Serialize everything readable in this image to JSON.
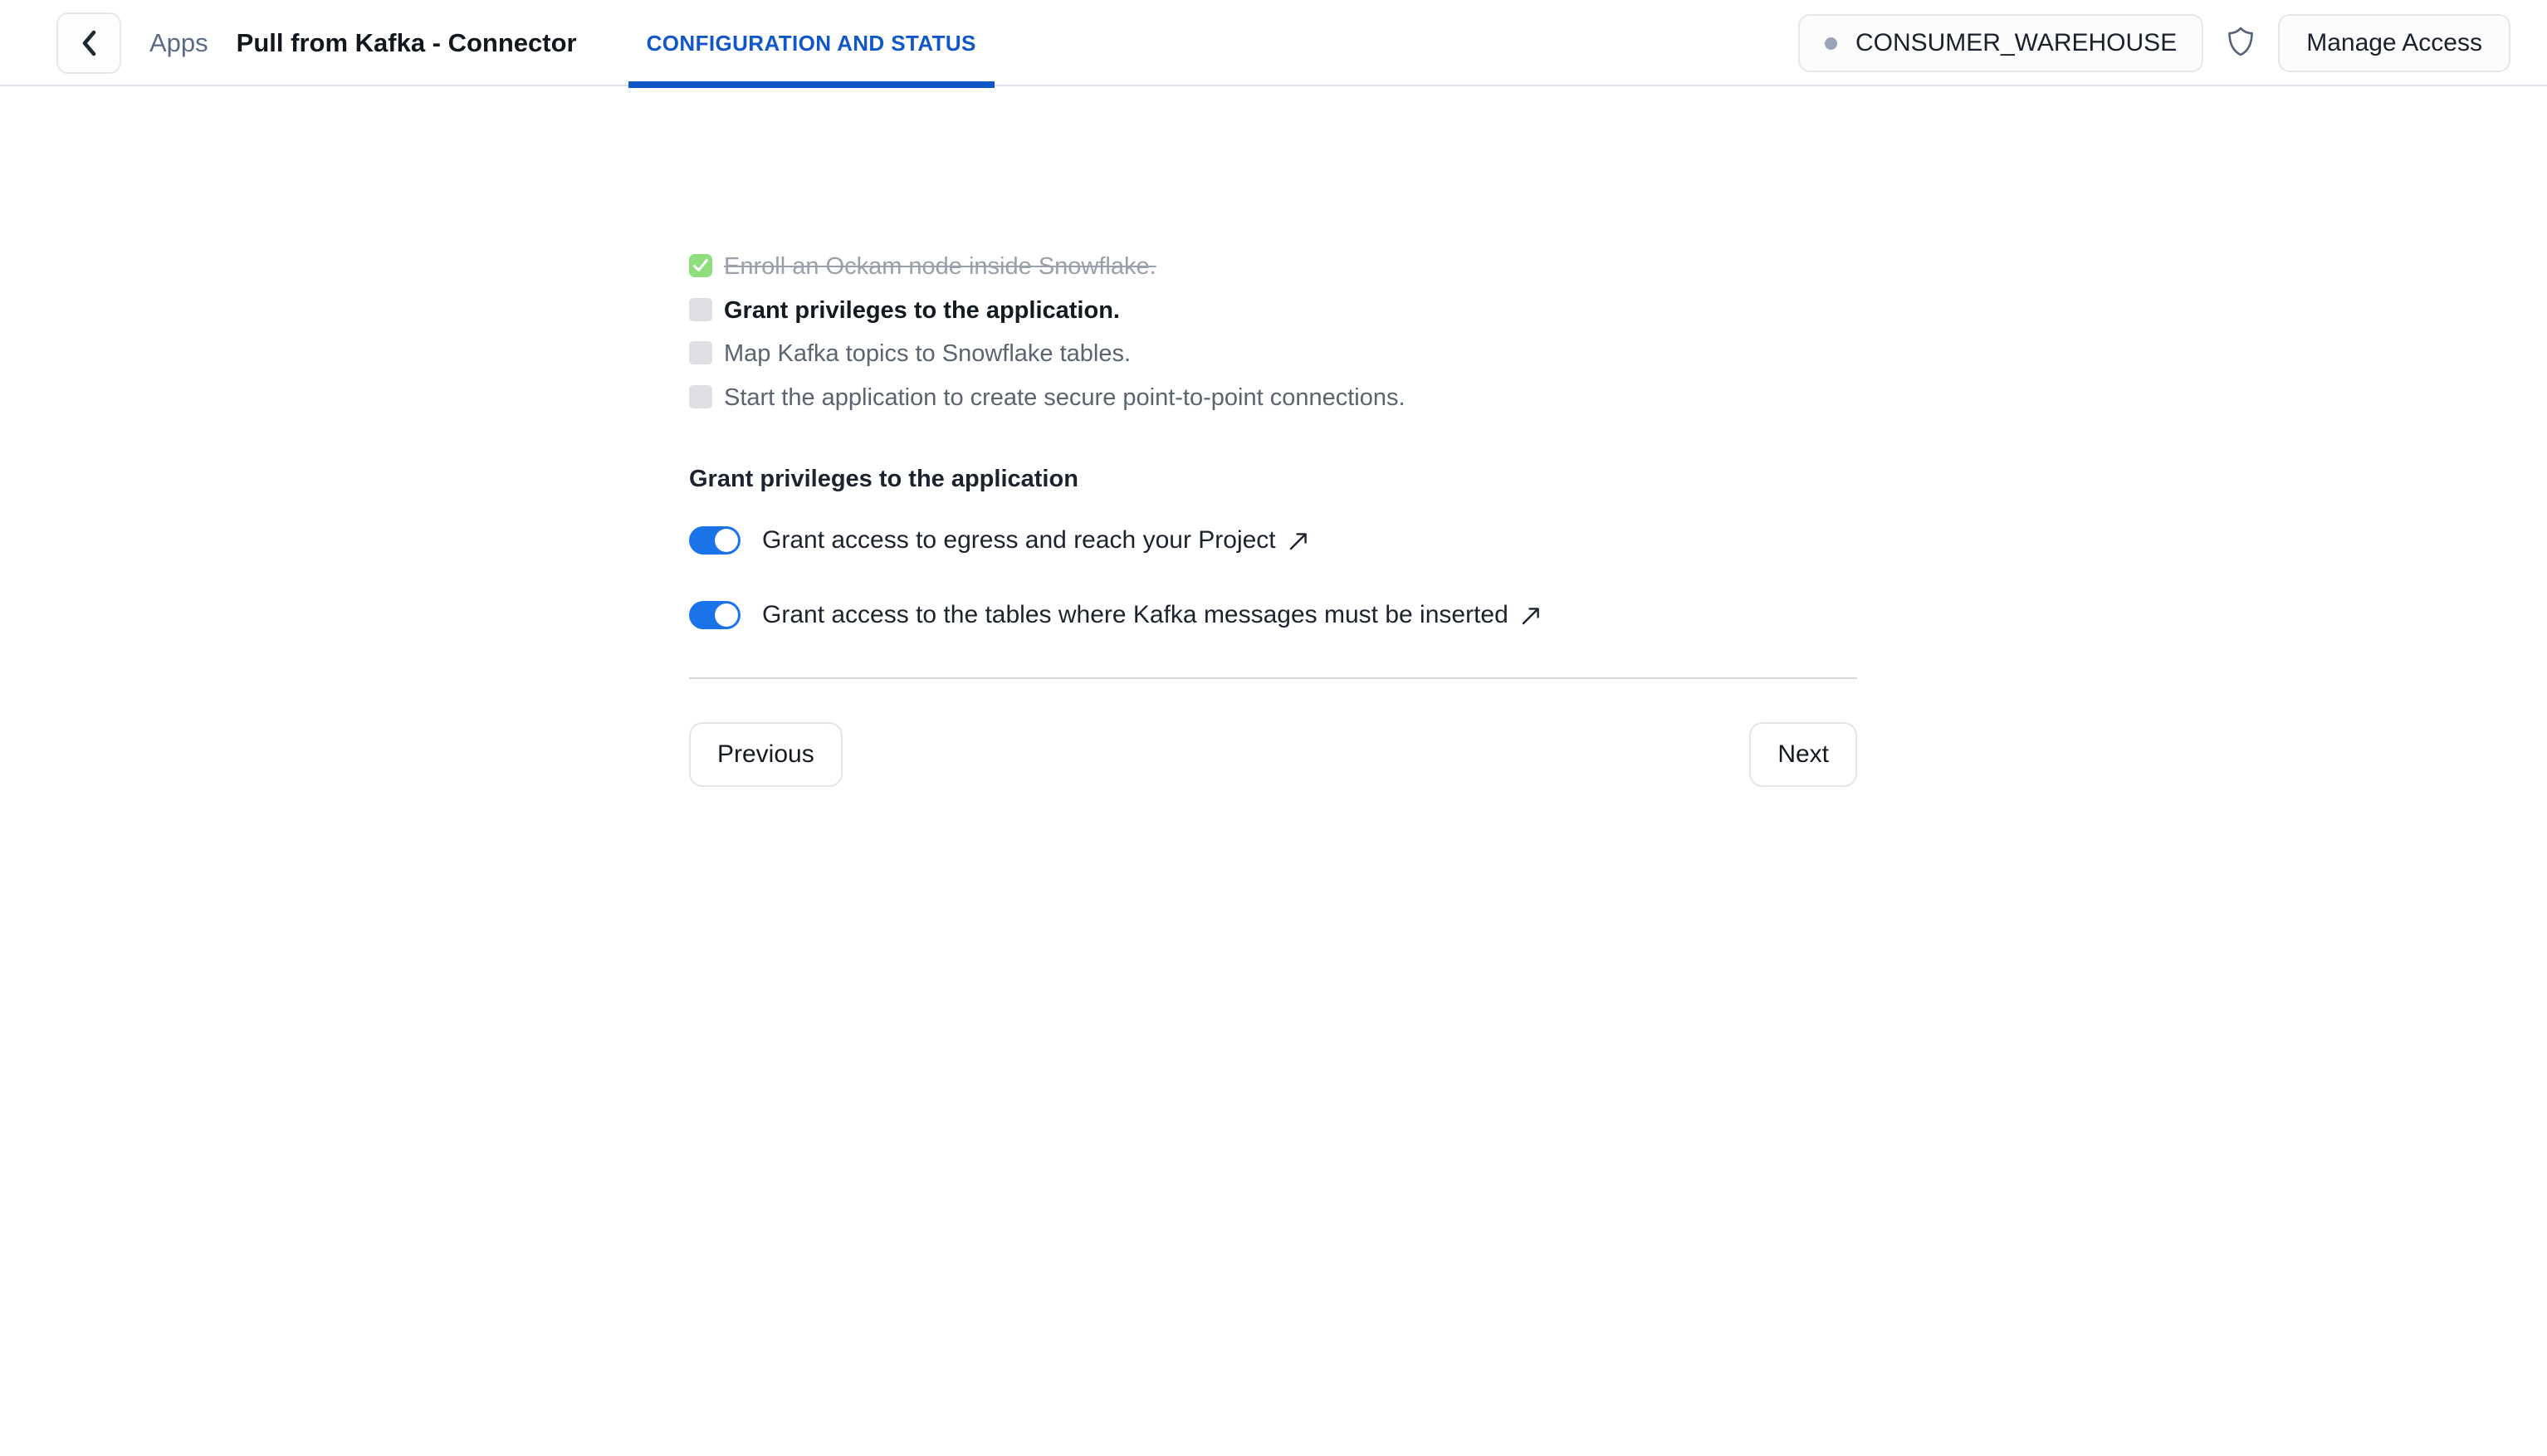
{
  "header": {
    "back_icon": "chevron-left-icon",
    "breadcrumb_apps": "Apps",
    "app_title": "Pull from Kafka - Connector",
    "tabs": [
      {
        "label": "CONFIGURATION AND STATUS",
        "active": true
      }
    ],
    "warehouse": {
      "name": "CONSUMER_WAREHOUSE",
      "status_dot_color": "#9aa3b8",
      "status_icon": "status-dot-icon"
    },
    "shield_icon": "shield-icon",
    "manage_access_label": "Manage Access",
    "tab_accent_color": "#0f56c7",
    "border_color": "#dfe3ed"
  },
  "checklist": {
    "items": [
      {
        "label": "Enroll an Ockam node inside Snowflake.",
        "state": "completed",
        "icon": "checkbox-checked-icon",
        "checkbox_color": "#8ede7e"
      },
      {
        "label": "Grant privileges to the application.",
        "state": "current",
        "icon": "checkbox-empty-icon",
        "checkbox_color": "#dddfe2"
      },
      {
        "label": "Map Kafka topics to Snowflake tables.",
        "state": "pending",
        "icon": "checkbox-empty-icon",
        "checkbox_color": "#dddfe2"
      },
      {
        "label": "Start the application to create secure point-to-point connections.",
        "state": "pending",
        "icon": "checkbox-empty-icon",
        "checkbox_color": "#dddfe2"
      }
    ]
  },
  "section": {
    "heading": "Grant privileges to the application",
    "toggles": [
      {
        "label": "Grant access to egress and reach your Project",
        "state": "on",
        "external_link_icon": "external-link-arrow-icon"
      },
      {
        "label": "Grant access to the tables where Kafka messages must be inserted",
        "state": "on",
        "external_link_icon": "external-link-arrow-icon"
      }
    ],
    "toggle_on_color": "#1a73e8"
  },
  "footer": {
    "previous_label": "Previous",
    "next_label": "Next"
  }
}
